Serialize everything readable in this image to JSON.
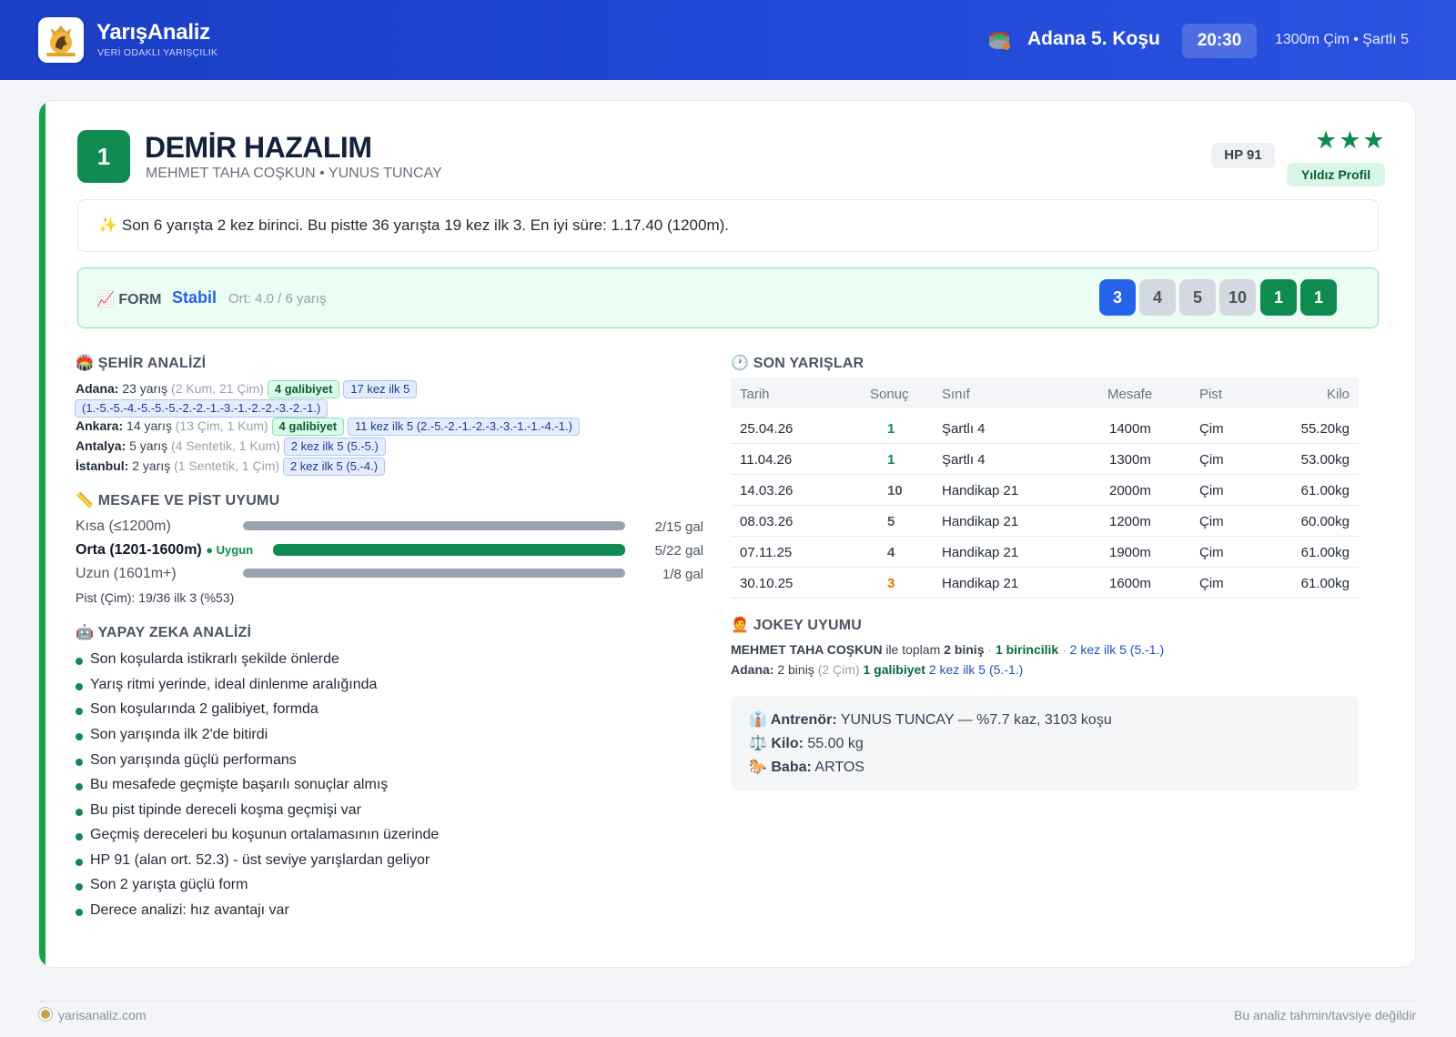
{
  "header": {
    "brand": "YarışAnaliz",
    "tagline": "VERİ ODAKLI YARIŞÇILIK",
    "race_title": "Adana 5. Koşu",
    "race_time": "20:30",
    "race_info": "1300m Çim • Şartlı 5"
  },
  "horse": {
    "number": "1",
    "name": "DEMİR HAZALIM",
    "sub": "MEHMET TAHA COŞKUN • YUNUS TUNCAY",
    "hp": "HP 91",
    "stars": "★★★",
    "star_label": "Yıldız Profil"
  },
  "summary": "✨ Son 6 yarışta 2 kez birinci. Bu pistte 36 yarışta 19 kez ilk 3. En iyi süre: 1.17.40 (1200m).",
  "form": {
    "label": "📈 FORM",
    "status": "Stabil",
    "avg": "Ort: 4.0 / 6 yarış",
    "positions": [
      "3",
      "4",
      "5",
      "10",
      "1",
      "1"
    ]
  },
  "city": {
    "title": "🏟️ ŞEHİR ANALİZİ",
    "rows": [
      {
        "city": "Adana:",
        "races": "23 yarış",
        "detail": "(2 Kum, 21 Çim)",
        "wins": "4 galibiyet",
        "top5": "17 kez ilk 5",
        "top5_detail": "(1.-5.-5.-4.-5.-5.-5.-2.-2.-1.-3.-1.-2.-2.-3.-2.-1.)"
      },
      {
        "city": "Ankara:",
        "races": "14 yarış",
        "detail": "(13 Çim, 1 Kum)",
        "wins": "4 galibiyet",
        "top5": "11 kez ilk 5 (2.-5.-2.-1.-2.-3.-3.-1.-1.-4.-1.)"
      },
      {
        "city": "Antalya:",
        "races": "5 yarış",
        "detail": "(4 Sentetik, 1 Kum)",
        "top5": "2 kez ilk 5 (5.-5.)"
      },
      {
        "city": "İstanbul:",
        "races": "2 yarış",
        "detail": "(1 Sentetik, 1 Çim)",
        "top5": "2 kez ilk 5 (5.-4.)"
      }
    ]
  },
  "distance": {
    "title": "📏 MESAFE VE PİST UYUMU",
    "rows": [
      {
        "label": "Kısa (≤1200m)",
        "stat": "2/15 gal"
      },
      {
        "label": "Orta (1201-1600m)",
        "badge": "● Uygun",
        "stat": "5/22 gal"
      },
      {
        "label": "Uzun (1601m+)",
        "stat": "1/8 gal"
      }
    ],
    "pist": "Pist (Çim): 19/36 ilk 3 (%53)"
  },
  "ai": {
    "title": "🤖 YAPAY ZEKA ANALİZİ",
    "items": [
      "Son koşularda istikrarlı şekilde önlerde",
      "Yarış ritmi yerinde, ideal dinlenme aralığında",
      "Son koşularında 2 galibiyet, formda",
      "Son yarışında ilk 2'de bitirdi",
      "Son yarışında güçlü performans",
      "Bu mesafede geçmişte başarılı sonuçlar almış",
      "Bu pist tipinde dereceli koşma geçmişi var",
      "Geçmiş dereceleri bu koşunun ortalamasının üzerinde",
      "HP 91 (alan ort. 52.3) - üst seviye yarışlardan geliyor",
      "Son 2 yarışta güçlü form",
      "Derece analizi: hız avantajı var"
    ]
  },
  "recent": {
    "title": "🕐 SON YARIŞLAR",
    "headers": [
      "Tarih",
      "Sonuç",
      "Sınıf",
      "Mesafe",
      "Pist",
      "Kilo"
    ],
    "rows": [
      {
        "date": "25.04.26",
        "result": "1",
        "color": "#0f8a51",
        "class": "Şartlı 4",
        "dist": "1400m",
        "track": "Çim",
        "kg": "55.20kg"
      },
      {
        "date": "11.04.26",
        "result": "1",
        "color": "#0f8a51",
        "class": "Şartlı 4",
        "dist": "1300m",
        "track": "Çim",
        "kg": "53.00kg"
      },
      {
        "date": "14.03.26",
        "result": "10",
        "color": "#4b5563",
        "class": "Handikap 21",
        "dist": "2000m",
        "track": "Çim",
        "kg": "61.00kg"
      },
      {
        "date": "08.03.26",
        "result": "5",
        "color": "#4b5563",
        "class": "Handikap 21",
        "dist": "1200m",
        "track": "Çim",
        "kg": "60.00kg"
      },
      {
        "date": "07.11.25",
        "result": "4",
        "color": "#4b5563",
        "class": "Handikap 21",
        "dist": "1900m",
        "track": "Çim",
        "kg": "61.00kg"
      },
      {
        "date": "30.10.25",
        "result": "3",
        "color": "#d97706",
        "class": "Handikap 21",
        "dist": "1600m",
        "track": "Çim",
        "kg": "61.00kg"
      }
    ]
  },
  "jockey": {
    "title": "🧑‍🦰 JOKEY UYUMU",
    "name": "MEHMET TAHA COŞKUN",
    "text1": " ile toplam ",
    "rides": "2 biniş",
    "sep": " · ",
    "wins": "1 birincilik",
    "top5": "2 kez ilk 5 (5.-1.)",
    "city": "Adana:",
    "city_rides": " 2 biniş ",
    "city_detail": "(2 Çim)",
    "city_wins": " 1 galibiyet",
    "city_top5": " 2 kez ilk 5 (5.-1.)"
  },
  "info": {
    "trainer_label": "👔 Antrenör:",
    "trainer_value": " YUNUS TUNCAY — %7.7 kaz, 3103 koşu",
    "kilo_label": "⚖️ Kilo:",
    "kilo_value": " 55.00 kg",
    "baba_label": "🐎 Baba:",
    "baba_value": " ARTOS"
  },
  "footer": {
    "site": "yarisanaliz.com",
    "disclaimer": "Bu analiz tahmin/tavsiye değildir"
  },
  "colors": {
    "accent": "#0f8a51",
    "header": "#2148d8",
    "form_blue": "#2563eb"
  }
}
